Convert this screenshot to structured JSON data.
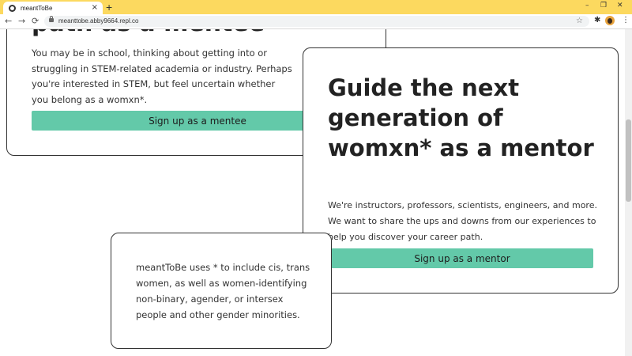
{
  "browser": {
    "tab_title": "meantToBe",
    "tab_close": "×",
    "new_tab": "+",
    "url": "meanttobe.abby9664.repl.co",
    "nav": {
      "back": "←",
      "forward": "→",
      "reload": "⟳"
    },
    "window_controls": {
      "minimize": "–",
      "restore": "❐",
      "close": "✕"
    },
    "icons": {
      "star": "☆",
      "extensions": "✱",
      "menu": "⋮"
    },
    "theme_color": "#fcd95f"
  },
  "mentee": {
    "heading": "path as a mentee",
    "description": "You may be in school, thinking about getting into or struggling in STEM-related academia or industry. Perhaps you're interested in STEM, but feel uncertain whether you belong as a womxn*.",
    "button_label": "Sign up as a mentee"
  },
  "mentor": {
    "heading": "Guide the next generation of womxn* as a mentor",
    "description": "We're instructors, professors, scientists, engineers, and more. We want to share the ups and downs from our experiences to help you discover your career path.",
    "button_label": "Sign up as a mentor"
  },
  "note": {
    "text": "meantToBe uses * to include cis, trans women, as well as women-identifying non-binary, agender, or intersex people and other gender minorities."
  },
  "colors": {
    "accent_button": "#63c9a9",
    "card_border": "#333333"
  }
}
